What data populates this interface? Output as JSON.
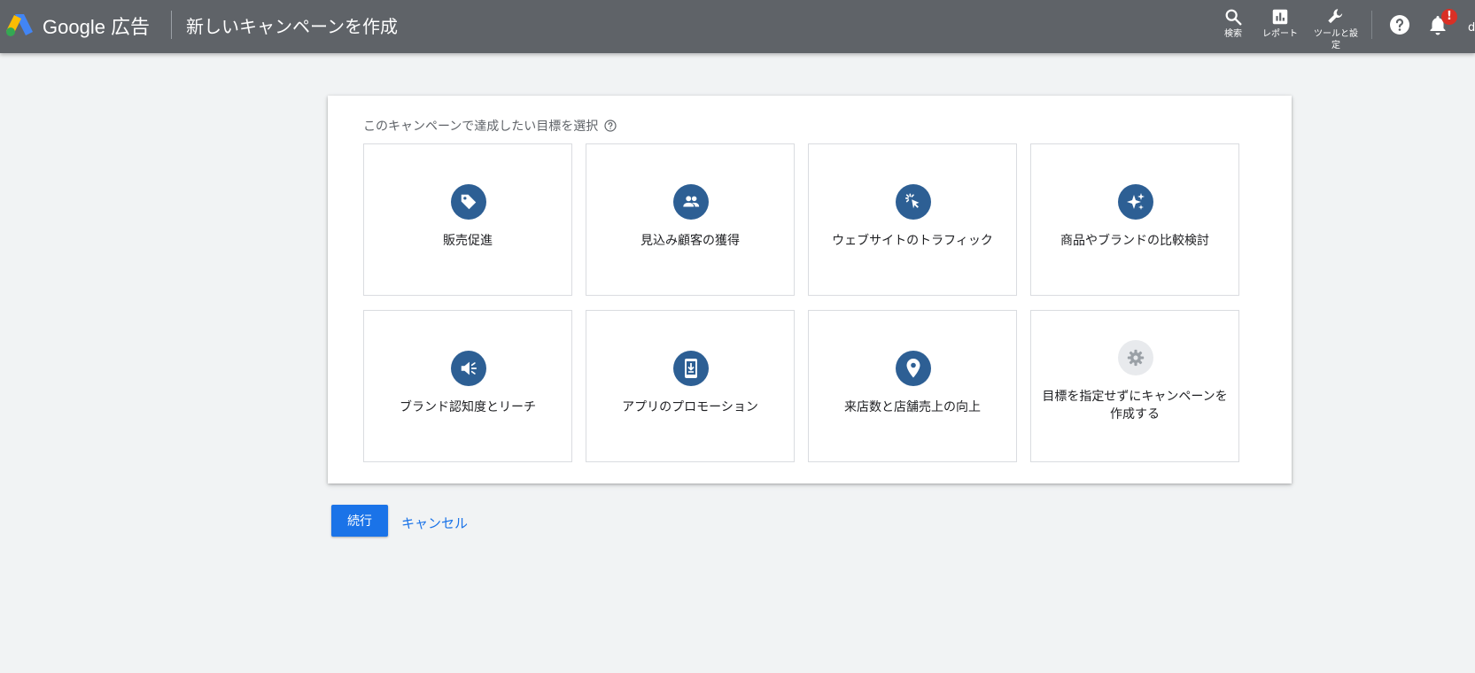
{
  "header": {
    "product_name": "Google 広告",
    "page_title": "新しいキャンペーンを作成",
    "tools": [
      {
        "icon": "search-icon",
        "label": "検索"
      },
      {
        "icon": "bar-chart-icon",
        "label": "レポート"
      },
      {
        "icon": "wrench-icon",
        "label": "ツールと設定"
      }
    ],
    "help_icon": "help-icon",
    "notifications": {
      "icon": "bell-icon",
      "badge": "!"
    },
    "account_initial": "d"
  },
  "goal_section": {
    "heading": "このキャンペーンで達成したい目標を選択",
    "goals": [
      {
        "icon": "tag-icon",
        "label": "販売促進"
      },
      {
        "icon": "people-icon",
        "label": "見込み顧客の獲得"
      },
      {
        "icon": "cursor-click-icon",
        "label": "ウェブサイトのトラフィック"
      },
      {
        "icon": "sparkle-icon",
        "label": "商品やブランドの比較検討"
      },
      {
        "icon": "megaphone-icon",
        "label": "ブランド認知度とリーチ"
      },
      {
        "icon": "phone-download-icon",
        "label": "アプリのプロモーション"
      },
      {
        "icon": "map-pin-icon",
        "label": "来店数と店舗売上の向上"
      },
      {
        "icon": "gear-icon",
        "label": "目標を指定せずにキャンペーンを作成する"
      }
    ]
  },
  "actions": {
    "continue_label": "続行",
    "cancel_label": "キャンセル"
  },
  "colors": {
    "header_bg": "#5f6368",
    "icon_circle": "#2d5f94",
    "primary": "#1a73e8",
    "page_bg": "#f1f3f4"
  }
}
